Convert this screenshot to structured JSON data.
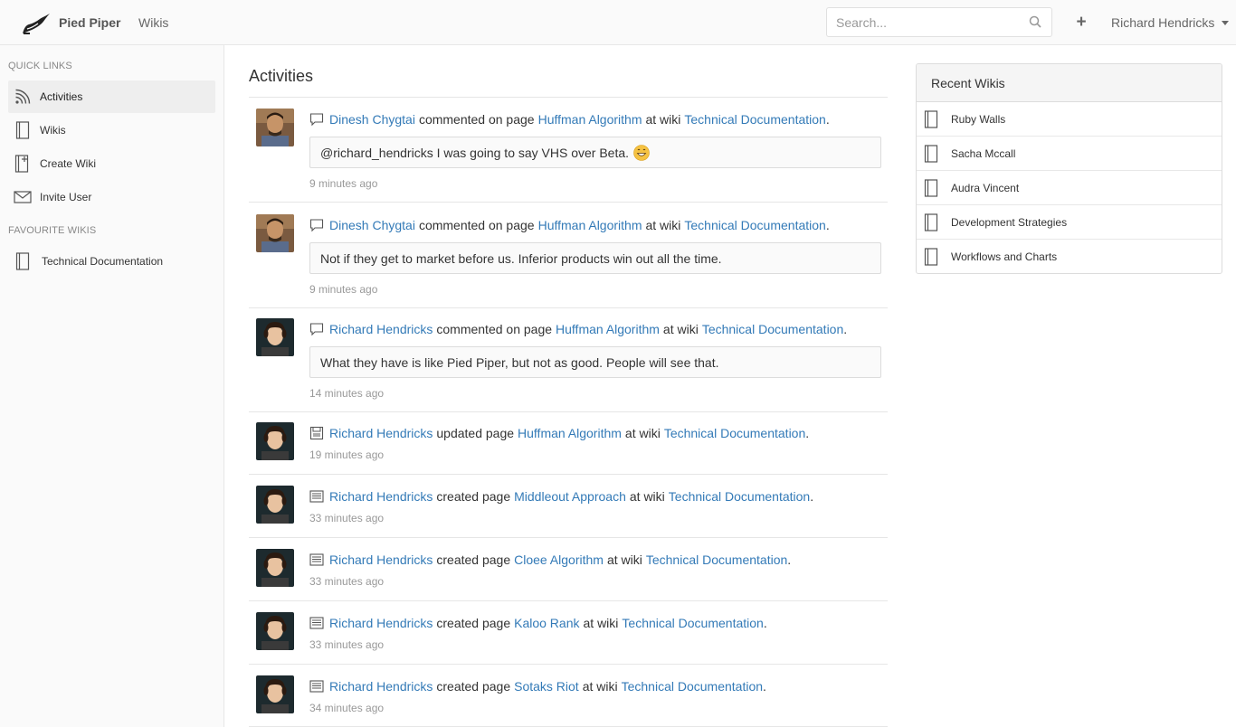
{
  "app": {
    "brand": "Pied Piper",
    "nav_wikis": "Wikis"
  },
  "search": {
    "placeholder": "Search..."
  },
  "user": {
    "name": "Richard Hendricks"
  },
  "sidebar": {
    "quick_links_title": "QUICK LINKS",
    "quick_links": [
      {
        "label": "Activities",
        "icon": "rss-icon",
        "active": true
      },
      {
        "label": "Wikis",
        "icon": "book-icon"
      },
      {
        "label": "Create Wiki",
        "icon": "book-plus-icon"
      },
      {
        "label": "Invite User",
        "icon": "envelope-icon"
      }
    ],
    "favourites_title": "FAVOURITE WIKIS",
    "favourites": [
      {
        "label": "Technical Documentation",
        "icon": "book-icon"
      }
    ]
  },
  "main": {
    "title": "Activities",
    "activities": [
      {
        "user": "Dinesh Chygtai",
        "action": "commented on page",
        "page": "Huffman Algorithm",
        "mid": "at wiki",
        "wiki": "Technical Documentation",
        "end": ".",
        "icon": "comment-icon",
        "comment": "@richard_hendricks I was going to say VHS over Beta.",
        "emoji": true,
        "time": "9 minutes ago"
      },
      {
        "user": "Dinesh Chygtai",
        "action": "commented on page",
        "page": "Huffman Algorithm",
        "mid": "at wiki",
        "wiki": "Technical Documentation",
        "end": ".",
        "icon": "comment-icon",
        "comment": "Not if they get to market before us. Inferior products win out all the time.",
        "time": "9 minutes ago"
      },
      {
        "user": "Richard Hendricks",
        "action": "commented on page",
        "page": "Huffman Algorithm",
        "mid": "at wiki",
        "wiki": "Technical Documentation",
        "end": ".",
        "icon": "comment-icon",
        "comment": "What they have is like Pied Piper, but not as good. People will see that.",
        "time": "14 minutes ago"
      },
      {
        "user": "Richard Hendricks",
        "action": "updated page",
        "page": "Huffman Algorithm",
        "mid": "at wiki",
        "wiki": "Technical Documentation",
        "end": ".",
        "icon": "save-icon",
        "time": "19 minutes ago"
      },
      {
        "user": "Richard Hendricks",
        "action": "created page",
        "page": "Middleout Approach",
        "mid": "at wiki",
        "wiki": "Technical Documentation",
        "end": ".",
        "icon": "page-icon",
        "time": "33 minutes ago"
      },
      {
        "user": "Richard Hendricks",
        "action": "created page",
        "page": "Cloee Algorithm",
        "mid": "at wiki",
        "wiki": "Technical Documentation",
        "end": ".",
        "icon": "page-icon",
        "time": "33 minutes ago"
      },
      {
        "user": "Richard Hendricks",
        "action": "created page",
        "page": "Kaloo Rank",
        "mid": "at wiki",
        "wiki": "Technical Documentation",
        "end": ".",
        "icon": "page-icon",
        "time": "33 minutes ago"
      },
      {
        "user": "Richard Hendricks",
        "action": "created page",
        "page": "Sotaks Riot",
        "mid": "at wiki",
        "wiki": "Technical Documentation",
        "end": ".",
        "icon": "page-icon",
        "time": "34 minutes ago"
      }
    ]
  },
  "recent_wikis": {
    "title": "Recent Wikis",
    "items": [
      {
        "label": "Ruby Walls"
      },
      {
        "label": "Sacha Mccall"
      },
      {
        "label": "Audra Vincent"
      },
      {
        "label": "Development Strategies"
      },
      {
        "label": "Workflows and Charts"
      }
    ]
  },
  "colors": {
    "link": "#337ab7",
    "topbar_bg": "#fafafa",
    "sidebar_bg": "#fafafa",
    "border": "#e7e7e7"
  }
}
